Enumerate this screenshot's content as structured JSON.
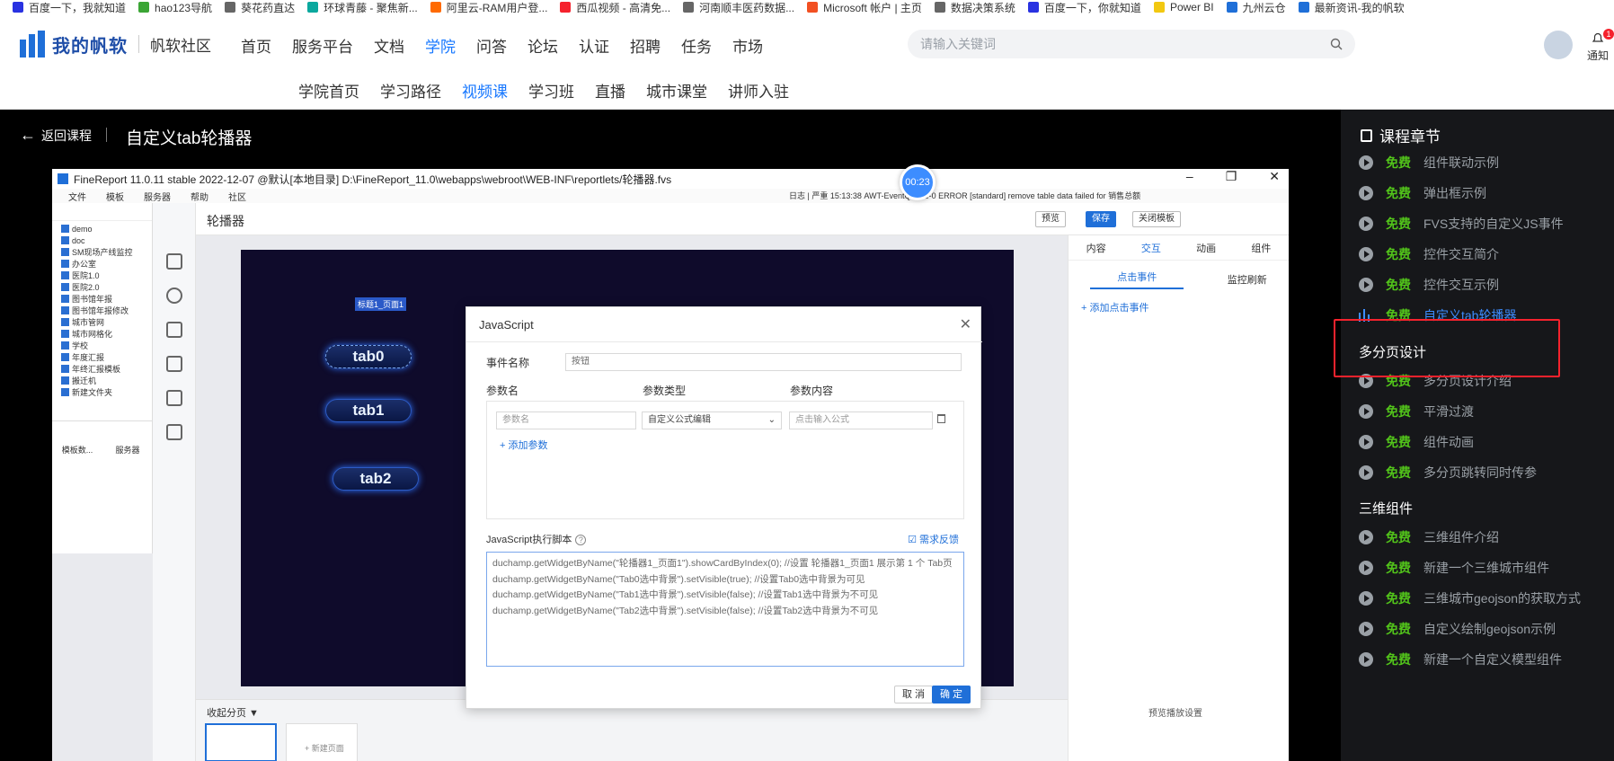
{
  "bookmarks": [
    {
      "label": "百度一下，我就知道",
      "color": "#2932e1"
    },
    {
      "label": "hao123导航",
      "color": "#3ba535"
    },
    {
      "label": "葵花药直达",
      "color": "#666666"
    },
    {
      "label": "环球青藤 - 聚焦新...",
      "color": "#0aa89e"
    },
    {
      "label": "阿里云-RAM用户登...",
      "color": "#ff6a00"
    },
    {
      "label": "西瓜视频 - 高清免...",
      "color": "#f5222d"
    },
    {
      "label": "河南顺丰医药数据...",
      "color": "#666666"
    },
    {
      "label": "Microsoft 帐户 | 主页",
      "color": "#f25022"
    },
    {
      "label": "数据决策系统",
      "color": "#666666"
    },
    {
      "label": "百度一下，你就知道",
      "color": "#2932e1"
    },
    {
      "label": "Power BI",
      "color": "#f2c811"
    },
    {
      "label": "九州云仓",
      "color": "#1f6fd8"
    },
    {
      "label": "最新资讯-我的帆软",
      "color": "#1f6fd8"
    }
  ],
  "header": {
    "logo_text": "我的帆软",
    "logo_sub": "帆软社区",
    "nav": [
      "首页",
      "服务平台",
      "文档",
      "学院",
      "问答",
      "论坛",
      "认证",
      "招聘",
      "任务",
      "市场"
    ],
    "nav_active": "学院",
    "search_placeholder": "请输入关键词",
    "notice_label": "通知",
    "notice_count": "1",
    "sub_nav": [
      "学院首页",
      "学习路径",
      "视频课",
      "学习班",
      "直播",
      "城市课堂",
      "讲师入驻"
    ],
    "sub_nav_active": "视频课"
  },
  "course_bar": {
    "back_label": "返回课程",
    "title": "自定义tab轮播器"
  },
  "video": {
    "timer": "00:23",
    "window_title": "FineReport 11.0.11 stable 2022-12-07 @默认[本地目录]    D:\\FineReport_11.0\\webapps\\webroot\\WEB-INF\\reportlets/轮播器.fvs",
    "menu": [
      "文件",
      "模板",
      "服务器",
      "帮助",
      "社区"
    ],
    "log_text": "日志 | 严重 15:13:38 AWT-EventQueue-0 ERROR [standard] remove table data failed for 销售总额",
    "tree": [
      "demo",
      "doc",
      "SM现场产线监控",
      "办公室",
      "医院1.0",
      "医院2.0",
      "图书馆年报",
      "图书馆年报修改",
      "城市管网",
      "城市网格化",
      "学校",
      "年度汇报",
      "年终汇报模板",
      "搬迁机",
      "新建文件夹"
    ],
    "left_tabs": [
      "模板数...",
      "服务器"
    ],
    "page_name": "轮播器",
    "btn_preview": "预览",
    "btn_save": "保存",
    "btn_close": "关闭模板",
    "tab_selected_label": "标题1_页面1",
    "tabs": [
      "tab0",
      "tab1",
      "tab2"
    ],
    "right_tabs": [
      "内容",
      "交互",
      "动画",
      "组件"
    ],
    "right_active": "交互",
    "right_sub": [
      "点击事件",
      "监控刷新"
    ],
    "right_sub_active": "点击事件",
    "add_click_event": "+ 添加点击事件",
    "collapse_pages": "收起分页 ▼",
    "preview_setting": "预览播放设置",
    "new_page": "+ 新建页面"
  },
  "dialog": {
    "title": "JavaScript",
    "event_name_label": "事件名称",
    "event_name_value": "按钮",
    "param_name_label": "参数名",
    "param_type_label": "参数类型",
    "param_value_label": "参数内容",
    "param_name_placeholder": "参数名",
    "param_type_value": "自定义公式编辑",
    "param_value_placeholder": "点击输入公式",
    "add_param": "+ 添加参数",
    "script_label": "JavaScript执行脚本",
    "feedback": "需求反馈",
    "script_lines": [
      "duchamp.getWidgetByName(\"轮播器1_页面1\").showCardByIndex(0); //设置 轮播器1_页面1 展示第 1 个 Tab页",
      "duchamp.getWidgetByName(\"Tab0选中背景\").setVisible(true); //设置Tab0选中背景为可见",
      "duchamp.getWidgetByName(\"Tab1选中背景\").setVisible(false); //设置Tab1选中背景为不可见",
      "duchamp.getWidgetByName(\"Tab2选中背景\").setVisible(false); //设置Tab2选中背景为不可见"
    ],
    "cancel": "取 消",
    "ok": "确 定"
  },
  "chapters": {
    "heading": "课程章节",
    "free_label": "免费",
    "groups": [
      {
        "section": "",
        "items": [
          "组件联动示例",
          "弹出框示例",
          "FVS支持的自定义JS事件",
          "控件交互简介",
          "控件交互示例",
          "自定义tab轮播器"
        ]
      },
      {
        "section": "多分页设计",
        "items": [
          "多分页设计介绍",
          "平滑过渡",
          "组件动画",
          "多分页跳转同时传参"
        ]
      },
      {
        "section": "三维组件",
        "items": [
          "三维组件介绍",
          "新建一个三维城市组件",
          "三维城市geojson的获取方式",
          "自定义绘制geojson示例",
          "新建一个自定义模型组件"
        ]
      }
    ],
    "active_item": "自定义tab轮播器"
  }
}
